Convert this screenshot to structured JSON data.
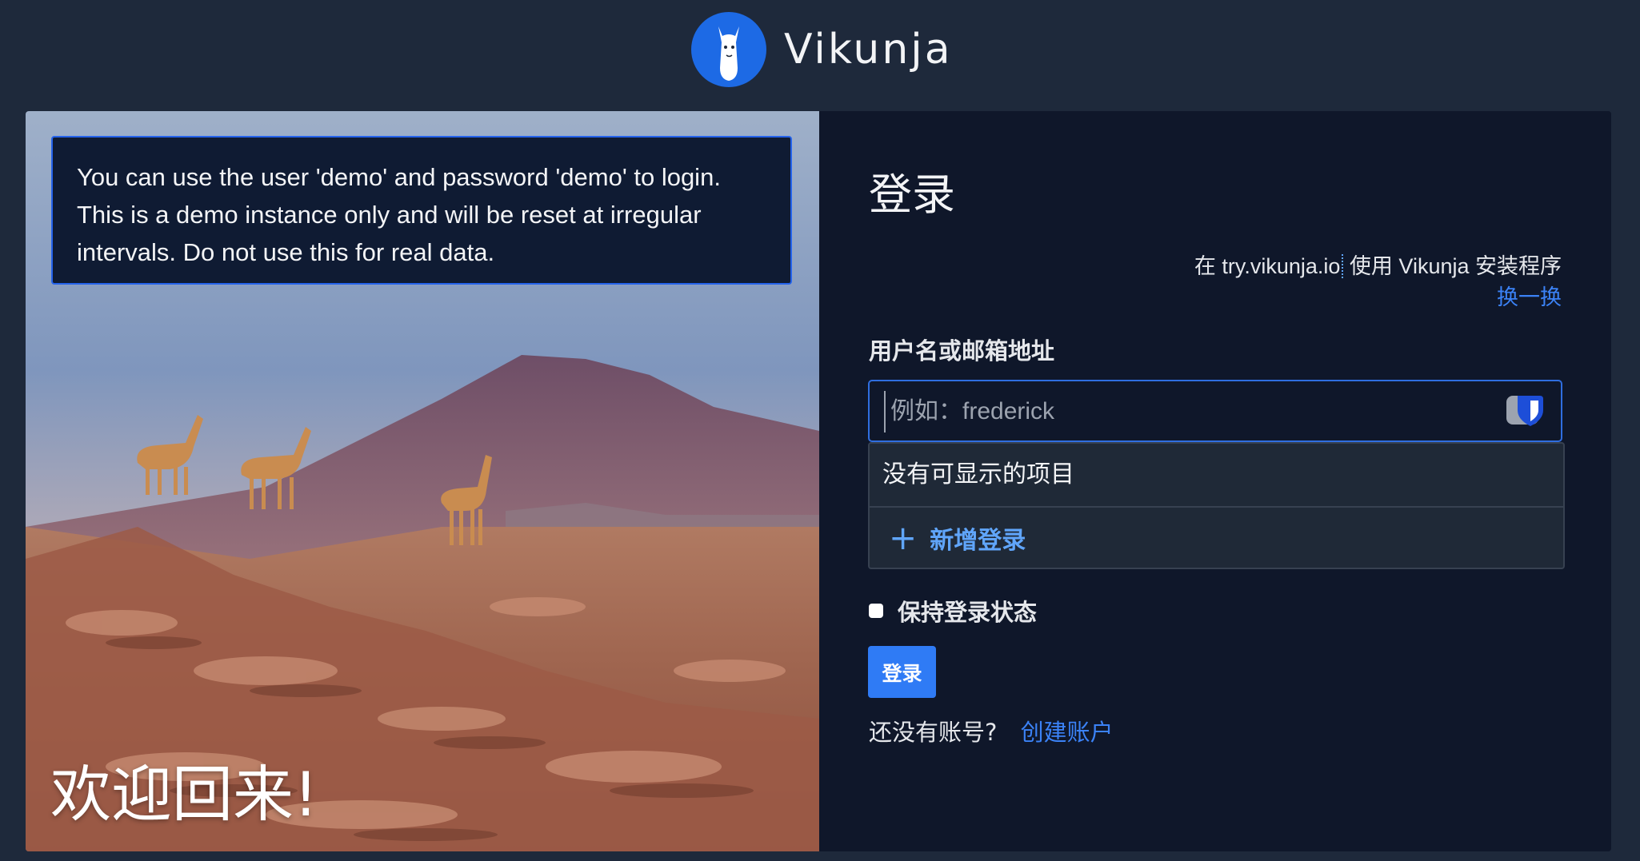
{
  "header": {
    "app_name": "Vikunja",
    "logo_icon": "llama-logo-icon"
  },
  "left_panel": {
    "demo_notice": "You can use the user 'demo' and password 'demo' to login. This is a demo instance only and will be reset at irregular intervals. Do not use this for real data.",
    "welcome_text": "欢迎回来!"
  },
  "login": {
    "title": "登录",
    "server_prefix": "在",
    "server_host": "try.vikunja.io",
    "server_suffix": "使用 Vikunja 安装程序",
    "change_server": "换一换",
    "username_label": "用户名或邮箱地址",
    "username_placeholder": "例如：frederick",
    "username_value": "",
    "autofill_empty": "没有可显示的项目",
    "autofill_add": "新增登录",
    "remember_label": "保持登录状态",
    "remember_checked": false,
    "submit_label": "登录",
    "no_account_text": "还没有账号?",
    "create_account_link": "创建账户"
  },
  "colors": {
    "background": "#1e293b",
    "card": "#0f172a",
    "accent": "#2f7bf5",
    "link": "#3b82f6"
  }
}
